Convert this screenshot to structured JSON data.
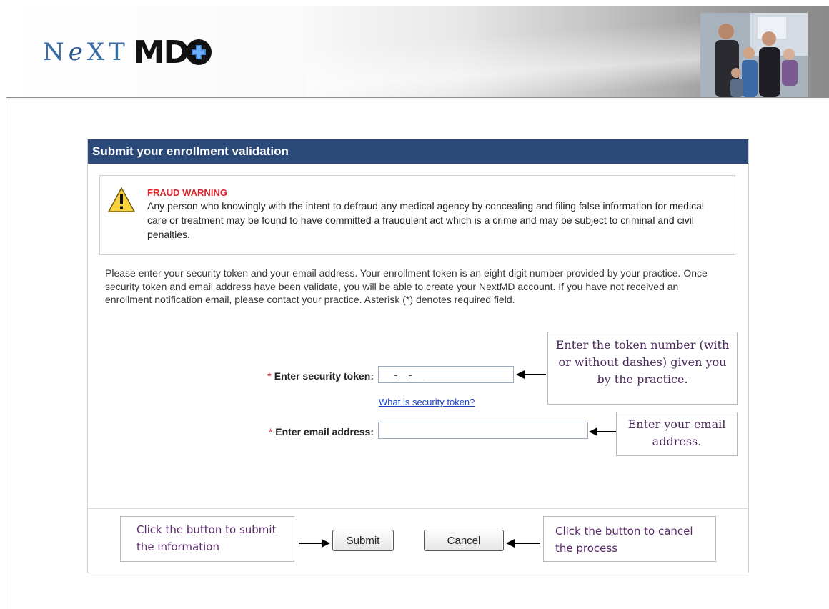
{
  "header": {
    "logo_next": "NeXT",
    "logo_md": "MD"
  },
  "panel": {
    "title": "Submit your enrollment validation",
    "warning": {
      "title": "FRAUD WARNING",
      "text": "Any person who knowingly with the intent to defraud any medical agency by concealing and filing false information for medical care or treatment may be found to have committed a fraudulent act which is a crime and may be subject to criminal and civil penalties."
    },
    "instructions": "Please enter your security token and your email address. Your enrollment token is an eight digit number provided by your practice. Once security token and email address have been validate, you will be able to create your NextMD account. If you have not received an enrollment notification email, please contact your practice. Asterisk (*) denotes required field.",
    "token": {
      "required_marker": "*",
      "label": "Enter security token:",
      "value": "__-__-__",
      "help_link": "What is security token?"
    },
    "email": {
      "required_marker": "*",
      "label": "Enter email address:",
      "value": ""
    },
    "buttons": {
      "submit": "Submit",
      "cancel": "Cancel"
    }
  },
  "callouts": {
    "token_note": "Enter the token number (with or without dashes) given you by the practice.",
    "email_note": "Enter your email address.",
    "submit_note": "Click the button to submit the information",
    "cancel_note": "Click the button to cancel the process"
  },
  "colors": {
    "title_bar": "#2b4a7a",
    "warning_red": "#d8262b",
    "link_blue": "#1a44c8",
    "callout_text": "#4a2a5a"
  }
}
